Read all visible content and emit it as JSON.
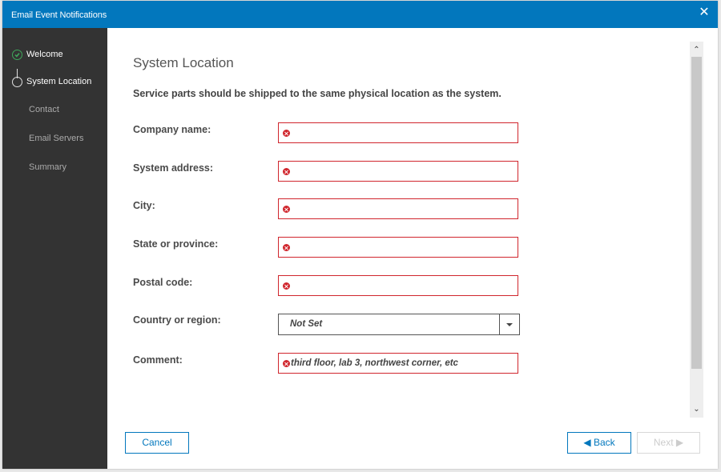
{
  "dialog": {
    "title": "Email Event Notifications",
    "close_icon": "close-icon"
  },
  "steps": [
    {
      "label": "Welcome",
      "state": "completed"
    },
    {
      "label": "System Location",
      "state": "current"
    },
    {
      "label": "Contact",
      "state": "pending"
    },
    {
      "label": "Email Servers",
      "state": "pending"
    },
    {
      "label": "Summary",
      "state": "pending"
    }
  ],
  "page": {
    "title": "System Location",
    "subtitle": "Service parts should be shipped to the same physical location as the system."
  },
  "form": {
    "company_name": {
      "label": "Company name:",
      "value": "",
      "status": "error"
    },
    "system_address": {
      "label": "System address:",
      "value": "",
      "status": "error"
    },
    "city": {
      "label": "City:",
      "value": "",
      "status": "error"
    },
    "state_province": {
      "label": "State or province:",
      "value": "",
      "status": "error"
    },
    "postal_code": {
      "label": "Postal code:",
      "value": "",
      "status": "error"
    },
    "country_region": {
      "label": "Country or region:",
      "selected": "Not Set"
    },
    "comment": {
      "label": "Comment:",
      "value": "",
      "placeholder": "third floor, lab 3, northwest corner, etc",
      "status": "error"
    }
  },
  "buttons": {
    "cancel": "Cancel",
    "back": "◀ Back",
    "next": "Next ▶"
  },
  "colors": {
    "titlebar": "#0277bd",
    "sidebar": "#333333",
    "error": "#d0262d",
    "completed": "#3fa65b"
  }
}
